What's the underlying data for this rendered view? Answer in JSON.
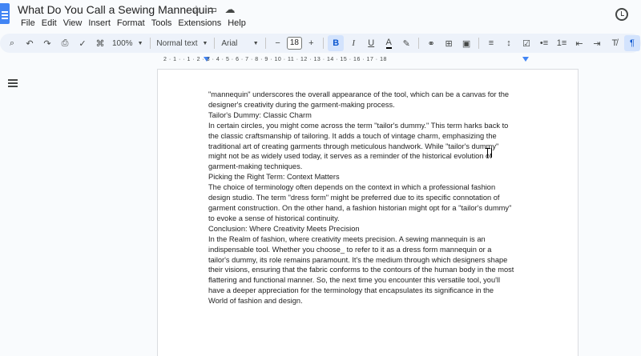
{
  "app": {
    "doc_title": "What Do You Call a Sewing Mannequin"
  },
  "menu": [
    "File",
    "Edit",
    "View",
    "Insert",
    "Format",
    "Tools",
    "Extensions",
    "Help"
  ],
  "toolbar": {
    "zoom": "100%",
    "style": "Normal text",
    "font": "Arial",
    "font_size": "18",
    "minus": "−",
    "plus": "+",
    "bold": "B",
    "italic": "I",
    "underline": "U",
    "text_color": "A"
  },
  "ruler": {
    "text": "2 · 1 · · 1 · 2 · 3 · 4 · 5 · 6 · 7 · 8 · 9 · 10 · 11 · 12 · 13 · 14 · 15 · 16 · 17 · 18"
  },
  "document": {
    "lines": [
      "\"mannequin\" underscores the overall appearance of the tool, which can be a canvas for the",
      "designer's creativity during the garment-making process.",
      "Tailor's Dummy: Classic Charm",
      "In certain circles, you might come across the term \"tailor's dummy.\" This term harks back to",
      "the classic craftsmanship of tailoring. It adds a touch of vintage charm, emphasizing the",
      "traditional art of creating garments through meticulous handwork. While \"tailor's dummy\"",
      "might not be as widely used today, it serves as a reminder of the historical evolution of",
      "garment-making techniques.",
      "Picking the Right Term: Context Matters",
      "The choice of terminology often depends on the context in which a professional fashion",
      "design studio. The term \"dress form\" might be preferred due to its specific connotation of",
      "garment construction. On the other hand, a fashion historian might opt for a \"tailor's dummy\"",
      "to evoke a sense of historical continuity.",
      "Conclusion: Where Creativity Meets Precision",
      "In the Realm of fashion, where creativity meets precision.  A sewing mannequin is an",
      "indispensable tool. Whether you choose_ to refer to it as a dress form mannequin or a",
      "tailor's dummy, its role remains paramount. It's the medium through which designers shape",
      "their visions, ensuring that the fabric conforms to the contours of the human body in the most",
      "flattering and functional manner. So, the next time you encounter this versatile tool, you'll",
      "have a deeper appreciation for the terminology that encapsulates its significance in the",
      "World of fashion and design."
    ]
  },
  "icons": {
    "star": "star-icon",
    "move": "folder-icon",
    "cloud": "cloud-icon",
    "history": "history-icon",
    "outline": "outline-icon"
  }
}
